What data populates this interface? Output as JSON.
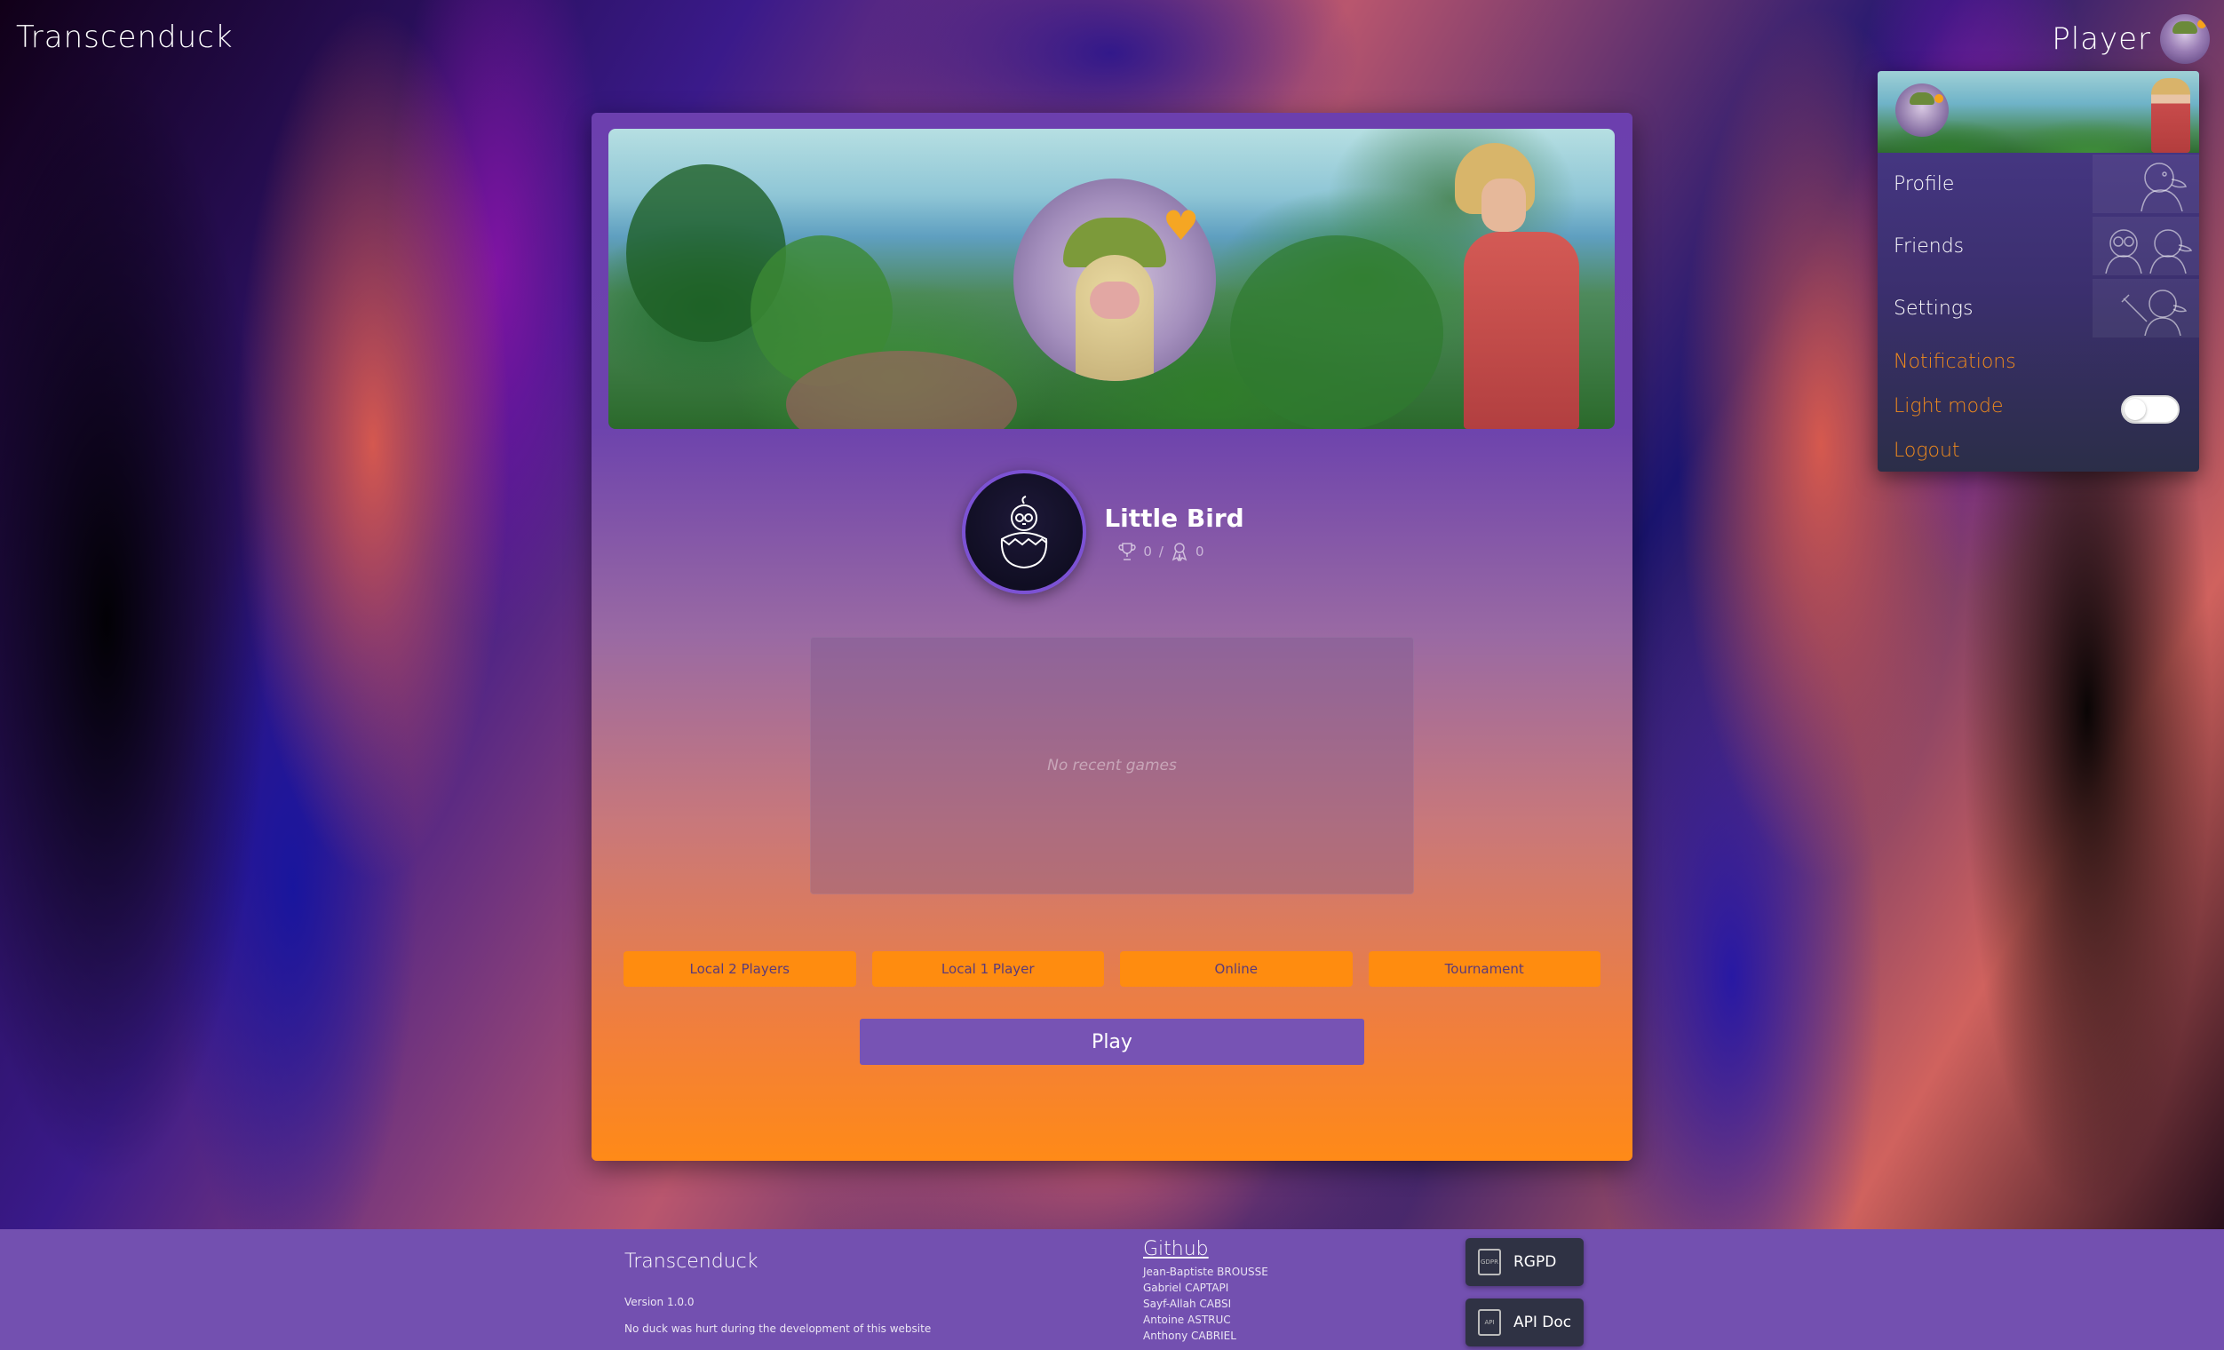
{
  "app": {
    "brand": "Transcenduck"
  },
  "header": {
    "player_name": "Player"
  },
  "menu": {
    "profile": "Profile",
    "friends": "Friends",
    "settings": "Settings",
    "notifications": "Notifications",
    "light_mode": "Light mode",
    "light_mode_on": false,
    "logout": "Logout"
  },
  "profile": {
    "name": "Little Bird",
    "wins": "0",
    "separator": "/",
    "losses": "0"
  },
  "recent_games": {
    "empty_text": "No recent games"
  },
  "modes": {
    "local2": "Local 2 Players",
    "local1": "Local 1 Player",
    "online": "Online",
    "tournament": "Tournament"
  },
  "play_label": "Play",
  "footer": {
    "title": "Transcenduck",
    "version": "Version 1.0.0",
    "tagline": "No duck was hurt during the development of this website",
    "github": "Github",
    "authors": [
      "Jean-Baptiste BROUSSE",
      "Gabriel CAPTAPI",
      "Sayf-Allah CABSI",
      "Antoine ASTRUC",
      "Anthony CABRIEL"
    ],
    "rgpd": "RGPD",
    "rgpd_icon_text": "GDPR",
    "api_doc": "API Doc",
    "api_icon_text": "API"
  },
  "colors": {
    "accent_orange": "#ff8c0f",
    "purple": "#7350b0",
    "link_orange": "#f08a1c"
  }
}
